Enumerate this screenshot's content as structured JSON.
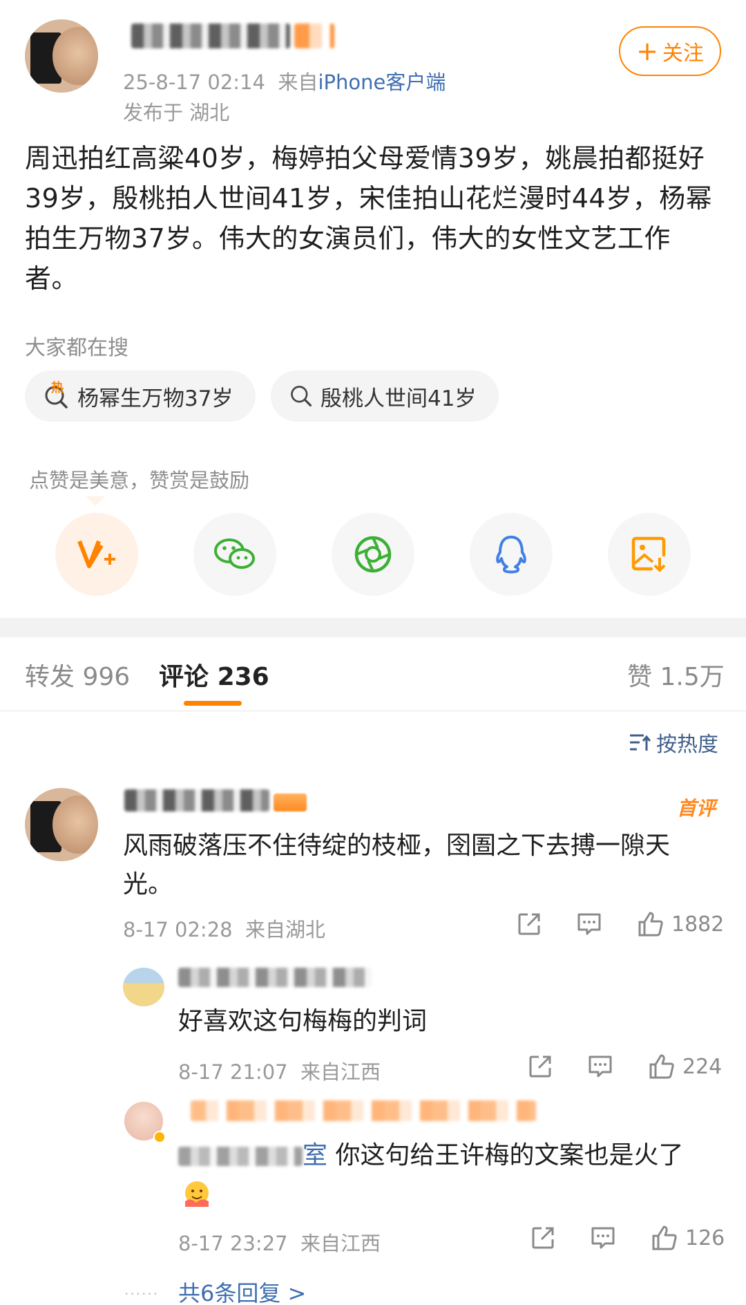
{
  "post": {
    "username_visible": "",
    "timestamp": "25-8-17 02:14",
    "source_prefix": "来自",
    "source_client": "iPhone客户端",
    "location": "发布于 湖北",
    "follow_label": "关注",
    "follow_plus": "+",
    "text": "周迅拍红高粱40岁，梅婷拍父母爱情39岁，姚晨拍都挺好39岁，殷桃拍人世间41岁，宋佳拍山花烂漫时44岁，杨幂拍生万物37岁。伟大的女演员们，伟大的女性文艺工作者。"
  },
  "search": {
    "label": "大家都在搜",
    "chips": [
      {
        "text": "杨幂生万物37岁",
        "icon": "hot-search-icon",
        "badge": "热"
      },
      {
        "text": "殷桃人世间41岁",
        "icon": "search-icon"
      }
    ]
  },
  "share": {
    "tooltip": "点赞是美意，赞赏是鼓励",
    "buttons": [
      {
        "name": "reward-button",
        "icon": "reward-v-icon",
        "color": "#ff8200"
      },
      {
        "name": "wechat-button",
        "icon": "wechat-icon",
        "color": "#3cb034"
      },
      {
        "name": "moments-button",
        "icon": "moments-icon",
        "color": "#3cb034"
      },
      {
        "name": "qq-button",
        "icon": "qq-icon",
        "color": "#3f7fe6"
      },
      {
        "name": "save-image-button",
        "icon": "save-image-icon",
        "color": "#ff9a00"
      }
    ]
  },
  "tabs": {
    "repost_label": "转发",
    "repost_count": "996",
    "comment_label": "评论",
    "comment_count": "236",
    "like_label": "赞",
    "like_count": "1.5万"
  },
  "sort": {
    "label": "按热度"
  },
  "comments": [
    {
      "badge": "首评",
      "text": "风雨破落压不住待绽的枝桠，囹圄之下去搏一隙天光。",
      "time": "8-17 02:28",
      "location": "来自湖北",
      "likes": "1882"
    },
    {
      "text": "好喜欢这句梅梅的判词",
      "time": "8-17 21:07",
      "location": "来自江西",
      "likes": "224"
    },
    {
      "mention_suffix": "室",
      "text": "你这句给王许梅的文案也是火了",
      "time": "8-17 23:27",
      "location": "来自江西",
      "likes": "126"
    }
  ],
  "more_replies": "共6条回复 >"
}
